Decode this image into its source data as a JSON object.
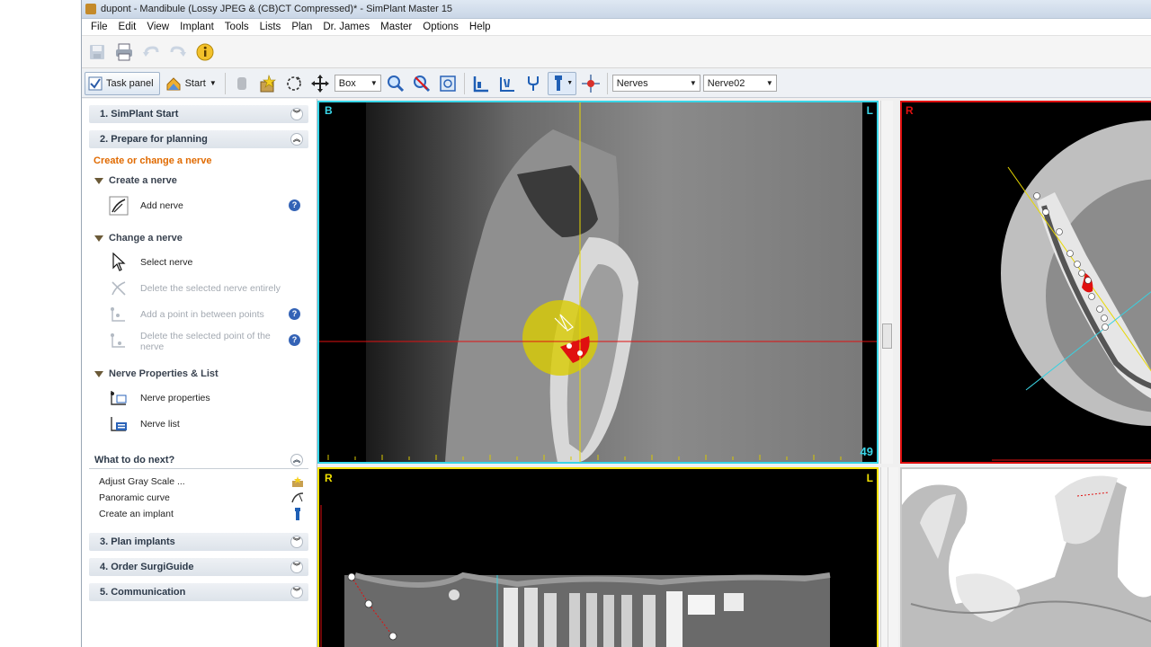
{
  "window": {
    "title": "dupont - Mandibule (Lossy JPEG & (CB)CT Compressed)* - SimPlant Master 15"
  },
  "menu": [
    "File",
    "Edit",
    "View",
    "Implant",
    "Tools",
    "Lists",
    "Plan",
    "Dr. James",
    "Master",
    "Options",
    "Help"
  ],
  "toolbar2": {
    "task_panel_label": "Task panel",
    "start_label": "Start",
    "mode_select": "Box",
    "nerves_select": "Nerves",
    "nerve_select": "Nerve02"
  },
  "panel": {
    "sections": {
      "start": "1. SimPlant Start",
      "prepare": "2. Prepare for planning",
      "plan_implants": "3. Plan implants",
      "order": "4. Order SurgiGuide",
      "communication": "5. Communication"
    },
    "active_title": "Create or change a nerve",
    "create_group": "Create a nerve",
    "add_nerve": "Add nerve",
    "change_group": "Change a nerve",
    "select_nerve": "Select nerve",
    "delete_nerve": "Delete the selected nerve entirely",
    "add_point": "Add a point in between points",
    "delete_point": "Delete the selected point of the nerve",
    "props_group": "Nerve Properties & List",
    "nerve_properties": "Nerve properties",
    "nerve_list": "Nerve list",
    "next_title": "What to do next?",
    "next_items": [
      "Adjust Gray Scale ...",
      "Panoramic curve",
      "Create an implant"
    ]
  },
  "views": {
    "cross": {
      "left": "B",
      "right": "L",
      "slice": "49"
    },
    "axial": {
      "left": "R"
    },
    "panoramic": {
      "left": "R",
      "right": "L"
    }
  },
  "colors": {
    "cross_border": "#39d6e8",
    "axial_border": "#e01010",
    "pano_border": "#f0e000",
    "accent_orange": "#e06a00",
    "nerve_red": "#e01010"
  }
}
